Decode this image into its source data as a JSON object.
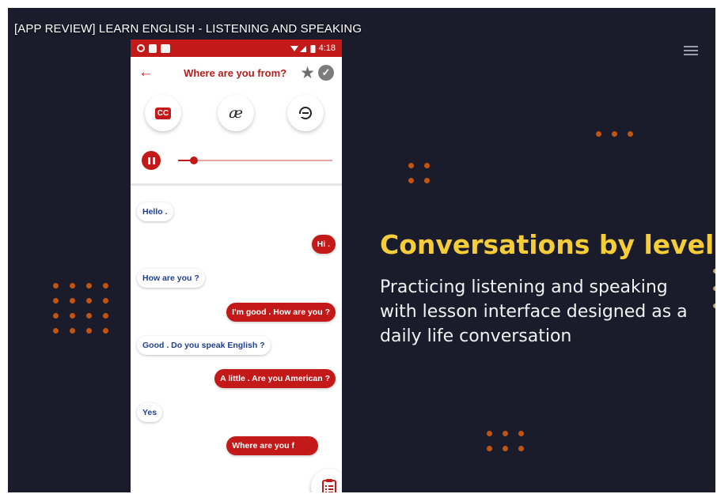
{
  "video": {
    "title": "[APP REVIEW] LEARN ENGLISH - LISTENING AND SPEAKING",
    "menu_icon": "hamburger-menu-icon"
  },
  "promo": {
    "headline": "Conversations by level",
    "description_lines": [
      "Practicing listening and speaking",
      "with lesson interface designed as a",
      "daily life conversation"
    ],
    "headline_color": "#f5cd38",
    "background_color": "#1a1b2b",
    "dot_color": "#c35410"
  },
  "phone": {
    "status_bar": {
      "time": "4:18",
      "color": "#c41919"
    },
    "app_bar": {
      "back_icon": "arrow-left-icon",
      "title": "Where are you from?",
      "favorite_icon": "star-icon",
      "done_icon": "check-circle-icon"
    },
    "tools": {
      "captions_label": "CC",
      "phonetics_label": "æ",
      "speech_icon": "face-speech-icon"
    },
    "player": {
      "state": "playing",
      "progress": 0.1
    },
    "conversation": [
      {
        "side": "in",
        "text": "Hello ."
      },
      {
        "side": "out",
        "text": "Hi ."
      },
      {
        "side": "in",
        "text": "How are you ?"
      },
      {
        "side": "out",
        "text": "I'm good . How are you ?"
      },
      {
        "side": "in",
        "text": "Good . Do you speak English ?"
      },
      {
        "side": "out",
        "text": "A little . Are you American ?"
      },
      {
        "side": "in",
        "text": "Yes"
      },
      {
        "side": "out",
        "text": "Where are you f"
      }
    ],
    "floating_button_icon": "clipboard-list-icon"
  }
}
